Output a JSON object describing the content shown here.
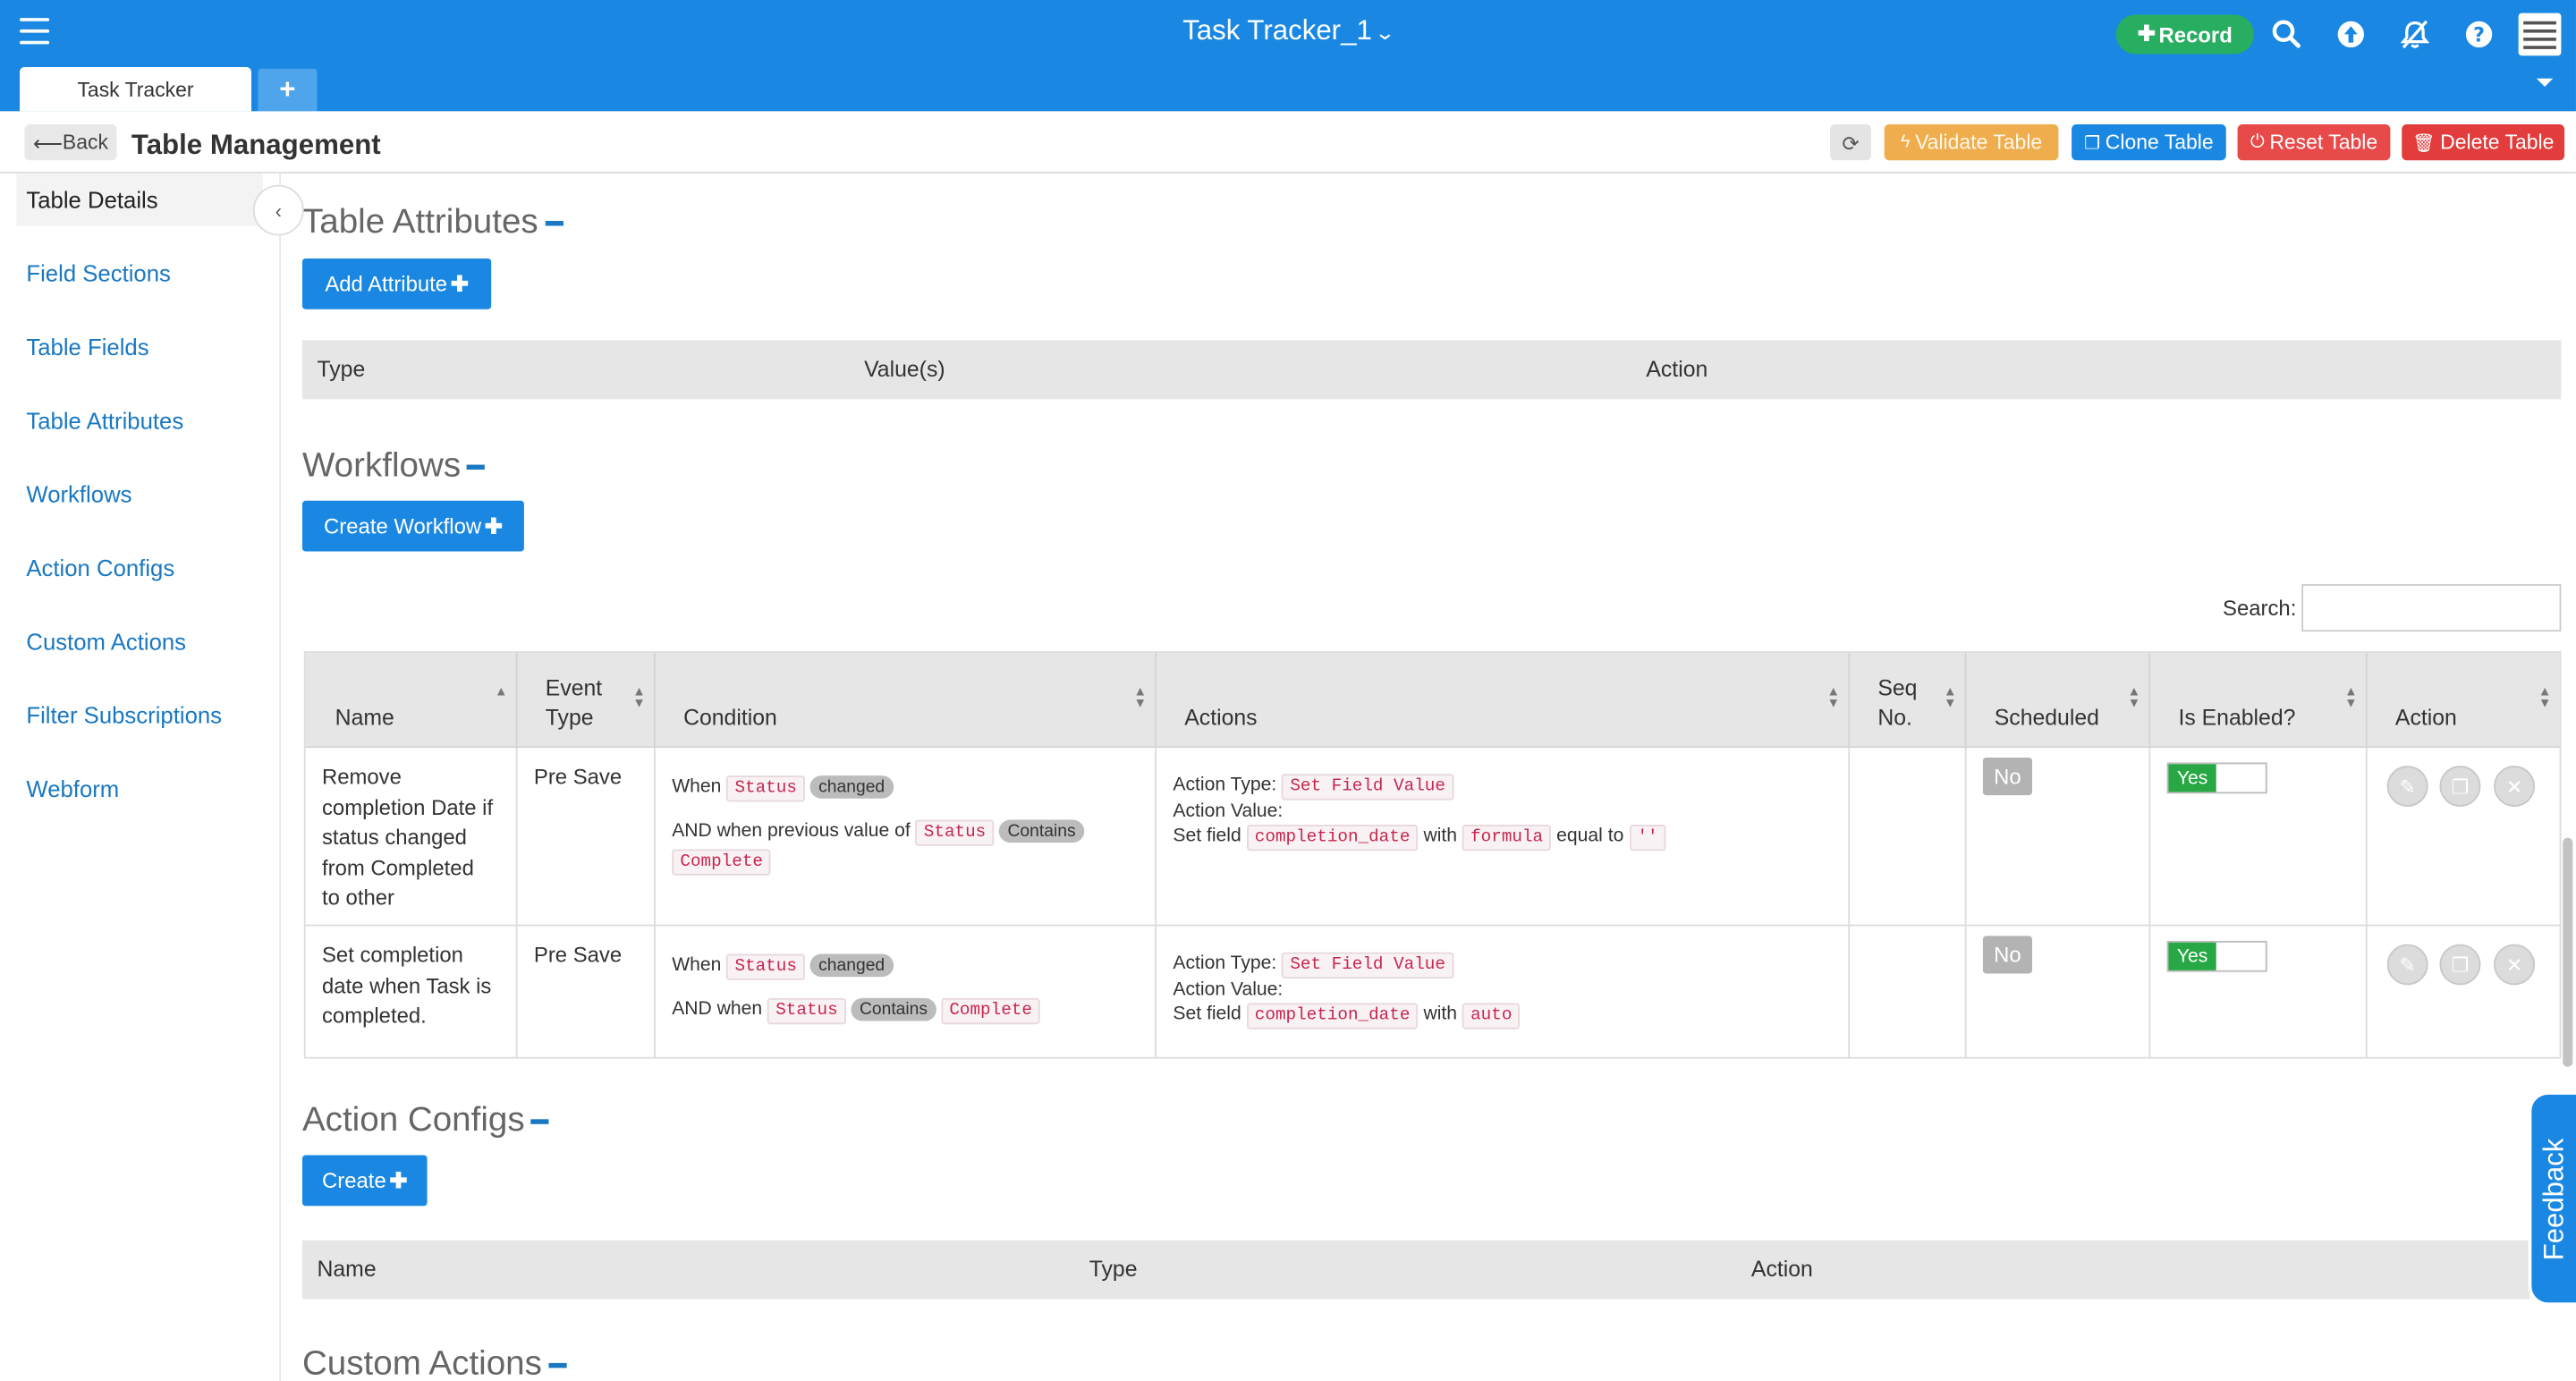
{
  "app": {
    "title": "Task Tracker_1",
    "record_label": "Record",
    "colors": {
      "primary": "#1a88e2",
      "success": "#27ae60",
      "warning": "#f0ad4e",
      "danger": "#e23c3c"
    }
  },
  "tabs": {
    "active": "Task Tracker",
    "add_label": "+"
  },
  "header": {
    "back_label": "Back",
    "page_title": "Table Management",
    "validate_label": "Validate Table",
    "clone_label": "Clone Table",
    "reset_label": "Reset Table",
    "delete_label": "Delete Table"
  },
  "sidebar": {
    "items": [
      {
        "label": "Table Details",
        "active": true
      },
      {
        "label": "Field Sections"
      },
      {
        "label": "Table Fields"
      },
      {
        "label": "Table Attributes"
      },
      {
        "label": "Workflows"
      },
      {
        "label": "Action Configs"
      },
      {
        "label": "Custom Actions"
      },
      {
        "label": "Filter Subscriptions"
      },
      {
        "label": "Webform"
      }
    ]
  },
  "table_attributes": {
    "title": "Table Attributes",
    "add_label": "Add Attribute",
    "columns": [
      "Type",
      "Value(s)",
      "Action"
    ]
  },
  "workflows": {
    "title": "Workflows",
    "create_label": "Create Workflow",
    "search_label": "Search:",
    "search_value": "",
    "columns": {
      "name": "Name",
      "event_type_1": "Event",
      "event_type_2": "Type",
      "condition": "Condition",
      "actions": "Actions",
      "seq_1": "Seq",
      "seq_2": "No.",
      "scheduled": "Scheduled",
      "enabled": "Is Enabled?",
      "action": "Action"
    },
    "rows": [
      {
        "name_lines": [
          "Remove",
          "completion Date if",
          "status changed",
          "from Completed",
          "to other"
        ],
        "event_type": "Pre Save",
        "cond": {
          "when": "When",
          "field": "Status",
          "op": "changed",
          "and_text": "AND when previous value of",
          "field2": "Status",
          "op2": "Contains",
          "value": "Complete"
        },
        "act": {
          "type_label": "Action Type:",
          "type_value": "Set Field Value",
          "value_label": "Action Value:",
          "set_text": "Set field",
          "field": "completion_date",
          "with_text": "with",
          "with_value": "formula",
          "equal_text": "equal to",
          "equal_value": "''"
        },
        "scheduled": "No",
        "enabled": "Yes"
      },
      {
        "name_lines": [
          "Set completion",
          "date when Task is",
          "completed."
        ],
        "event_type": "Pre Save",
        "cond": {
          "when": "When",
          "field": "Status",
          "op": "changed",
          "and_text": "AND when",
          "field2": "Status",
          "op2": "Contains",
          "value": "Complete"
        },
        "act": {
          "type_label": "Action Type:",
          "type_value": "Set Field Value",
          "value_label": "Action Value:",
          "set_text": "Set field",
          "field": "completion_date",
          "with_text": "with",
          "with_value": "auto"
        },
        "scheduled": "No",
        "enabled": "Yes"
      }
    ]
  },
  "action_configs": {
    "title": "Action Configs",
    "create_label": "Create",
    "columns": [
      "Name",
      "Type",
      "Action"
    ]
  },
  "custom_actions": {
    "title": "Custom Actions"
  },
  "feedback": {
    "label": "Feedback"
  }
}
